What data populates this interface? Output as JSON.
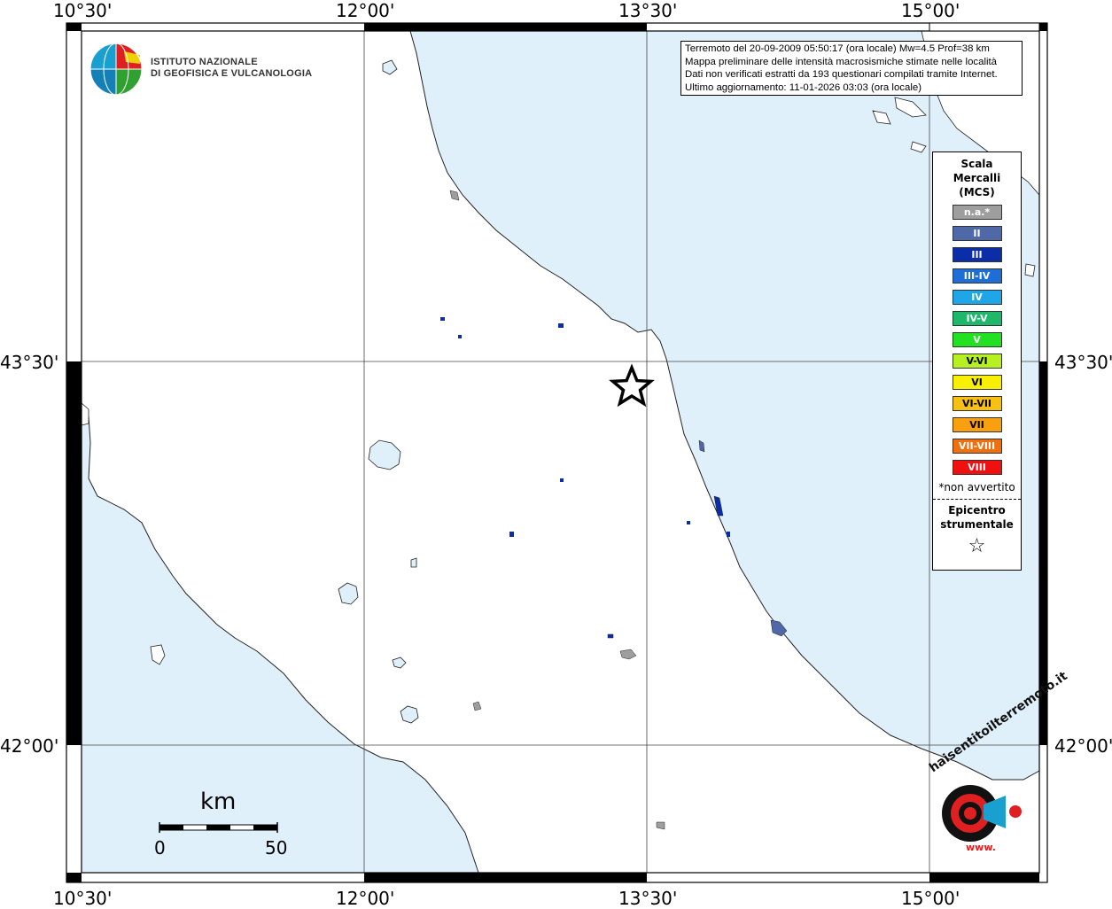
{
  "ticks": {
    "lon": [
      "10°30'",
      "12°00'",
      "13°30'",
      "15°00'"
    ],
    "lat": [
      "43°30'",
      "42°00'"
    ]
  },
  "info": {
    "line1": "Terremoto del 20-09-2009 05:50:17 (ora locale) Mw=4.5 Prof=38 km",
    "line2": "Mappa preliminare delle intensità macrosismiche stimate nelle località",
    "line3": "Dati non verificati estratti da 193 questionari compilati tramite Internet.",
    "line4": "Ultimo aggiornamento: 11-01-2026 03:03 (ora locale)"
  },
  "legend": {
    "title": [
      "Scala",
      "Mercalli",
      "(MCS)"
    ],
    "items": [
      {
        "label": "n.a.*",
        "color": "#9e9e9e"
      },
      {
        "label": "II",
        "color": "#4f68a8"
      },
      {
        "label": "III",
        "color": "#0b2ea8"
      },
      {
        "label": "III-IV",
        "color": "#1f6ed8"
      },
      {
        "label": "IV",
        "color": "#1fa6e8"
      },
      {
        "label": "IV-V",
        "color": "#1fb86a"
      },
      {
        "label": "V",
        "color": "#22e022"
      },
      {
        "label": "V-VI",
        "color": "#b6f020"
      },
      {
        "label": "VI",
        "color": "#f8f000"
      },
      {
        "label": "VI-VII",
        "color": "#f8c010"
      },
      {
        "label": "VII",
        "color": "#f8a010"
      },
      {
        "label": "VII-VIII",
        "color": "#f07010"
      },
      {
        "label": "VIII",
        "color": "#f01010"
      }
    ],
    "note": "*non avvertito",
    "epicentre": [
      "Epicentro",
      "strumentale"
    ],
    "star": "☆"
  },
  "logo": {
    "line1": "ISTITUTO NAZIONALE",
    "line2": "DI GEOFISICA E VULCANOLOGIA"
  },
  "scalebar": {
    "title": "km",
    "min": "0",
    "max": "50"
  },
  "badge": {
    "text_top": "haisentitoilterremoto.it",
    "text_bottom": "www."
  },
  "colors": {
    "sea": "#dff0fb",
    "land": "#ffffff",
    "intensity_ii": "#4f68a8",
    "intensity_iii": "#0b2ea8"
  }
}
